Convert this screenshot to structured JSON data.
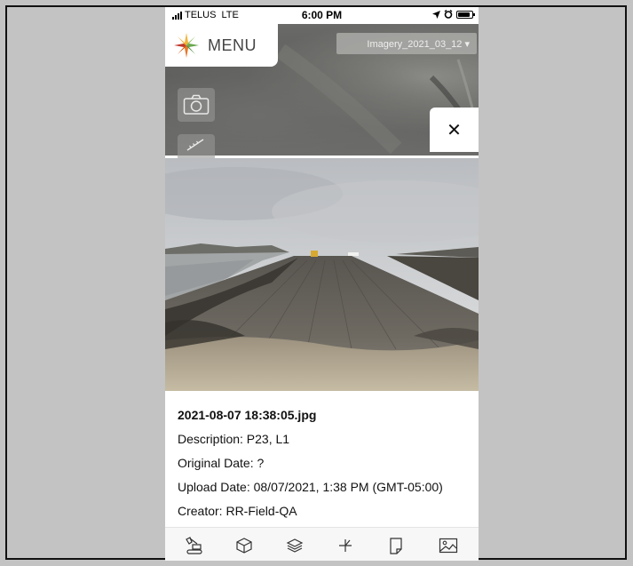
{
  "status_bar": {
    "carrier": "TELUS",
    "network": "LTE",
    "time": "6:00 PM"
  },
  "map": {
    "menu_label": "MENU",
    "imagery_selected": "Imagery_2021_03_12 ▾",
    "tools": [
      "camera-icon",
      "ruler-icon"
    ],
    "close_glyph": "✕"
  },
  "photo_info": {
    "filename": "2021-08-07 18:38:05.jpg",
    "description": "Description: P23, L1",
    "original_date": "Original Date: ?",
    "upload_date": "Upload Date: 08/07/2021, 1:38 PM (GMT-05:00)",
    "creator": "Creator: RR-Field-QA"
  },
  "toolbar": {
    "items": [
      "excavator-icon",
      "cube-icon",
      "layers-icon",
      "survey-icon",
      "document-icon",
      "image-icon"
    ]
  },
  "colors": {
    "logo_orange": "#e8772a",
    "logo_green": "#6aa84f",
    "logo_yellow": "#f2b53a",
    "logo_red": "#c0392b"
  }
}
